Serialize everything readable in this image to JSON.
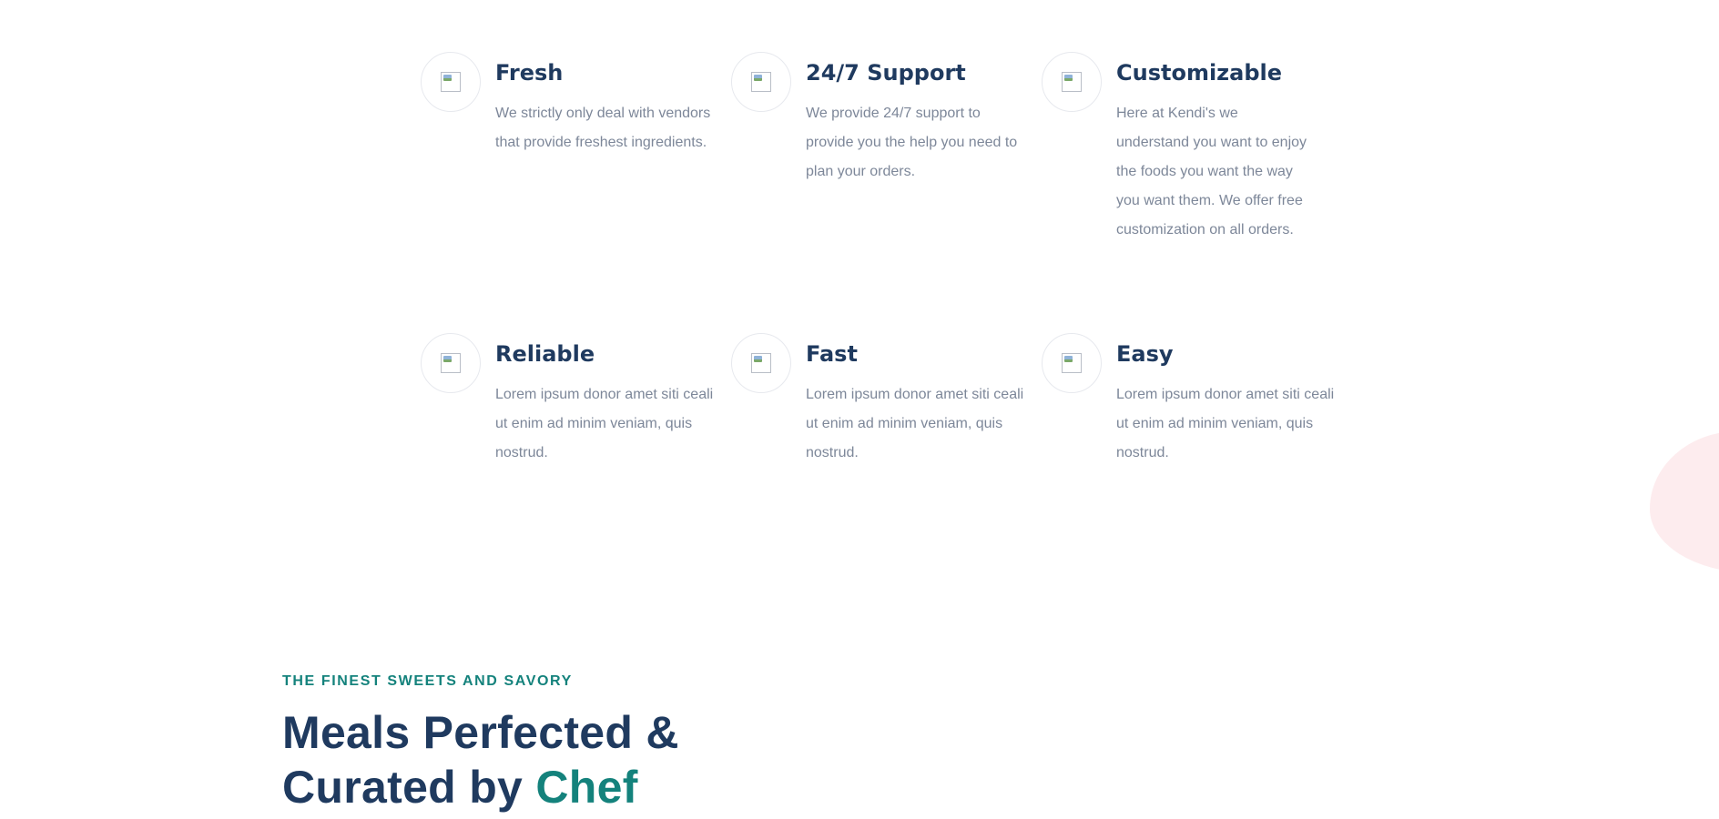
{
  "features": [
    {
      "icon": "image-placeholder-icon",
      "title": "Fresh",
      "description": "We strictly only deal with vendors that provide freshest ingredients."
    },
    {
      "icon": "image-placeholder-icon",
      "title": "24/7 Support",
      "description": "We provide 24/7 support to provide you the help you need to plan your orders."
    },
    {
      "icon": "image-placeholder-icon",
      "title": "Customizable",
      "description": "Here at Kendi's we understand you want to enjoy the foods you want the way you want them. We offer free customization on all orders."
    },
    {
      "icon": "image-placeholder-icon",
      "title": "Reliable",
      "description": "Lorem ipsum donor amet siti ceali ut enim ad minim veniam, quis nostrud."
    },
    {
      "icon": "image-placeholder-icon",
      "title": "Fast",
      "description": "Lorem ipsum donor amet siti ceali ut enim ad minim veniam, quis nostrud."
    },
    {
      "icon": "image-placeholder-icon",
      "title": "Easy",
      "description": "Lorem ipsum donor amet siti ceali ut enim ad minim veniam, quis nostrud."
    }
  ],
  "section": {
    "eyebrow": "THE FINEST SWEETS AND SAVORY",
    "headline_line1": "Meals Perfected &",
    "headline_line2": "Curated by ",
    "headline_accent": "Chef"
  },
  "colors": {
    "heading": "#1f3a5f",
    "body_text": "#7d8799",
    "accent": "#14827c",
    "blob": "#fdecee"
  }
}
